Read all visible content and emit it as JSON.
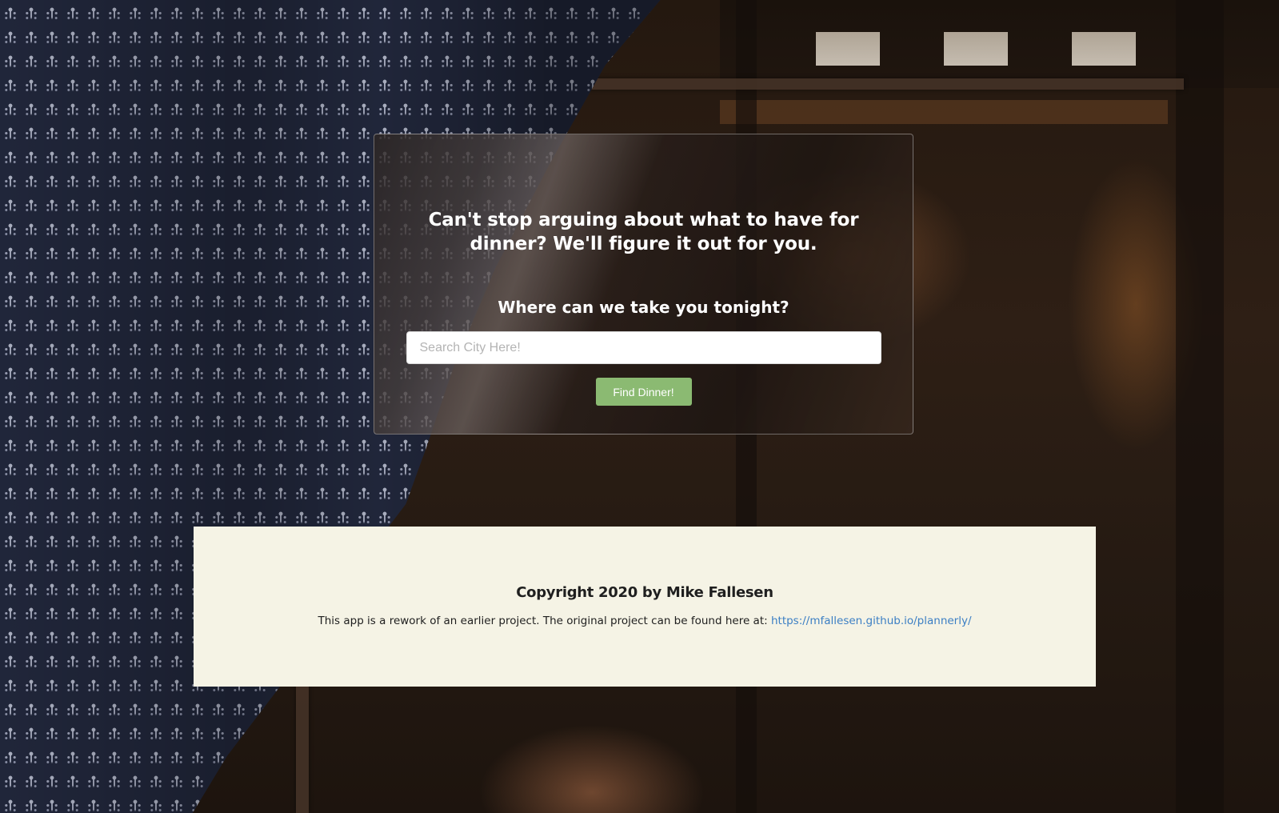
{
  "hero": {
    "headline": "Can't stop arguing about what to have for dinner? We'll figure it out for you.",
    "subheading": "Where can we take you tonight?",
    "search": {
      "placeholder": "Search City Here!",
      "value": ""
    },
    "button_label": "Find Dinner!"
  },
  "footer": {
    "copyright": "Copyright 2020 by Mike Fallesen",
    "description": "This app is a rework of an earlier project. The original project can be found here at:",
    "link_text": "https://mfallesen.github.io/plannerly/"
  },
  "colors": {
    "button": "#8bba72",
    "footer_background": "#f5f3e5",
    "link": "#3c7fc4"
  },
  "background": {
    "icon": "restaurant-window-photo"
  }
}
